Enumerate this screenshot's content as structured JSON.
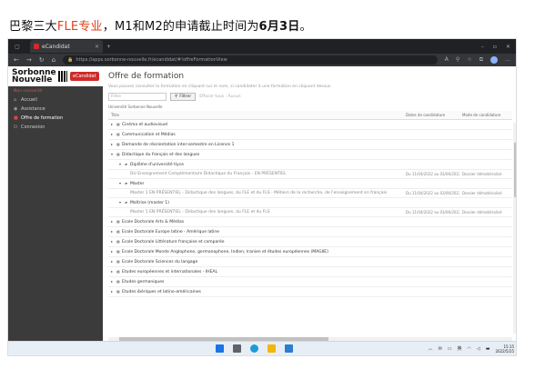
{
  "caption": {
    "prefix": "巴黎三大",
    "highlight": "FLE专业",
    "middle": "，M1和M2的申请截止时间为",
    "bold": "6月3日",
    "suffix": "。"
  },
  "browser": {
    "tab_title": "eCandidat",
    "url": "https://apps.sorbonne-nouvelle.fr/ecandidat/#!offreFormationView"
  },
  "app": {
    "brand": "Sorbonne Nouvelle",
    "brand_badge": "eCandidat",
    "sidebar_subtitle": "Non connecté",
    "sidebar_items": [
      {
        "label": "Accueil",
        "icon": "home-icon"
      },
      {
        "label": "Assistance",
        "icon": "help-icon"
      },
      {
        "label": "Offre de formation",
        "icon": "list-icon"
      },
      {
        "label": "Connexion",
        "icon": "login-icon"
      }
    ],
    "page_title": "Offre de formation",
    "description": "Vous pouvez consulter la formation en cliquant sur le nom, si candidater à une formation en cliquant dessus.",
    "filter_placeholder": "Filtre",
    "filter_button": "Filtrer",
    "reset_label": "Effacer tous : Aucun",
    "university_label": "Université Sorbonne Nouvelle",
    "columns": [
      "Titre",
      "",
      "Dates de candidature",
      "Mode de candidature"
    ],
    "rows": [
      {
        "title": "Cinéma et audiovisuel",
        "level": 0,
        "toggle": "▸",
        "date": "",
        "mode": ""
      },
      {
        "title": "Communication et Médias",
        "level": 0,
        "toggle": "▸",
        "date": "",
        "mode": ""
      },
      {
        "title": "Demande de réorientation inter-semestre en Licence 1",
        "level": 0,
        "toggle": "▸",
        "date": "",
        "mode": ""
      },
      {
        "title": "Didactique du français et des langues",
        "level": 0,
        "toggle": "▾",
        "date": "",
        "mode": ""
      },
      {
        "title": "Diplôme d'université tiyce",
        "level": 1,
        "toggle": "▾",
        "date": "",
        "mode": ""
      },
      {
        "title": "DU Enseignement Complémentaire Didactique du Français - EN PRÉSENTIEL",
        "level": 3,
        "toggle": "",
        "date": "Du 11/04/2022 au 03/06/2022",
        "mode": "Dossier dématérialisé"
      },
      {
        "title": "Master",
        "level": 1,
        "toggle": "▾",
        "date": "",
        "mode": ""
      },
      {
        "title": "Master 1 EN PRÉSENTIEL - Didactique des langues, du FLE et du FLS - Métiers de la recherche, de l'enseignement en français",
        "level": 3,
        "toggle": "",
        "date": "Du 11/04/2022 au 03/06/2022",
        "mode": "Dossier dématérialisé"
      },
      {
        "title": "Maîtrise (master 1)",
        "level": 1,
        "toggle": "▾",
        "date": "",
        "mode": ""
      },
      {
        "title": "Master 1 EN PRÉSENTIEL - Didactique des langues, du FLE et du FLS",
        "level": 3,
        "toggle": "",
        "date": "Du 11/04/2022 au 03/06/2022",
        "mode": "Dossier dématérialisé"
      },
      {
        "title": "Ecole Doctorale Arts & Médias",
        "level": 0,
        "toggle": "▸",
        "date": "",
        "mode": ""
      },
      {
        "title": "Ecole Doctorale Europe latine - Amérique latine",
        "level": 0,
        "toggle": "▸",
        "date": "",
        "mode": ""
      },
      {
        "title": "Ecole Doctorale Littérature française et comparée",
        "level": 0,
        "toggle": "▸",
        "date": "",
        "mode": ""
      },
      {
        "title": "Ecole Doctorale Monde Anglophone, germanophone, Indien, Iranien et études européennes (MAGIIE)",
        "level": 0,
        "toggle": "▸",
        "date": "",
        "mode": ""
      },
      {
        "title": "Ecole Doctorale Sciences du langage",
        "level": 0,
        "toggle": "▸",
        "date": "",
        "mode": ""
      },
      {
        "title": "Etudes européennes et internationales - IHEAL",
        "level": 0,
        "toggle": "▸",
        "date": "",
        "mode": ""
      },
      {
        "title": "Etudes germaniques",
        "level": 0,
        "toggle": "▸",
        "date": "",
        "mode": ""
      },
      {
        "title": "Etudes ibériques et latino-américaines",
        "level": 0,
        "toggle": "▸",
        "date": "",
        "mode": ""
      }
    ]
  },
  "taskbar": {
    "time": "15:15",
    "date": "2022/5/25",
    "lang": "英"
  }
}
